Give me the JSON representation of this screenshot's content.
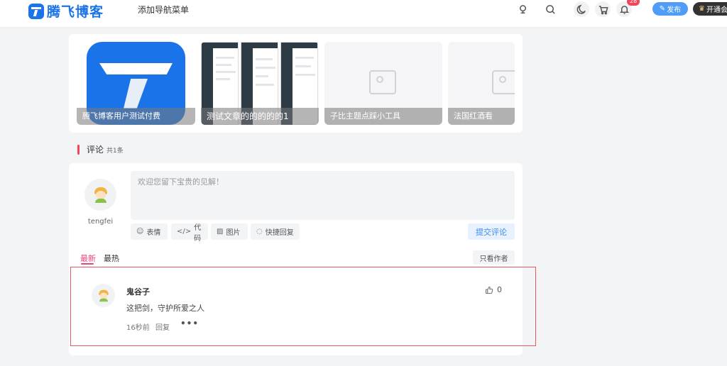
{
  "header": {
    "logo_text": "腾飞博客",
    "nav_add": "添加导航菜单",
    "notification_count": "28",
    "publish_label": "发布",
    "vip_label": "开通会",
    "icons": [
      "sign-in-icon",
      "search-icon",
      "moon-icon",
      "cart-icon",
      "bell-icon"
    ]
  },
  "related": {
    "posts": [
      {
        "title": "腾飞博客用户测试付费"
      },
      {
        "title": "测试文章的的的的的1"
      },
      {
        "title": "子比主题点踩小工具"
      },
      {
        "title": "法国红酒看"
      }
    ]
  },
  "comments": {
    "section_title": "评论",
    "count_text": "共1条",
    "me": {
      "name": "tengfei"
    },
    "input_placeholder": "欢迎您留下宝贵的见解！",
    "tools": {
      "emoji": "表情",
      "code": "代码",
      "image": "图片",
      "quick_reply": "快捷回复"
    },
    "submit_label": "提交评论",
    "tabs": {
      "latest": "最新",
      "hot": "最热"
    },
    "only_author": "只看作者",
    "items": [
      {
        "author": "鬼谷子",
        "text": "这把剑，守护所爱之人",
        "time": "16秒前",
        "reply_label": "回复",
        "more": "•••",
        "likes": "0"
      }
    ]
  },
  "colors": {
    "brand": "#1a73e8",
    "accent_pink": "#e8457e",
    "publish_blue": "#4f9df7",
    "highlight_red": "#e8575a"
  }
}
